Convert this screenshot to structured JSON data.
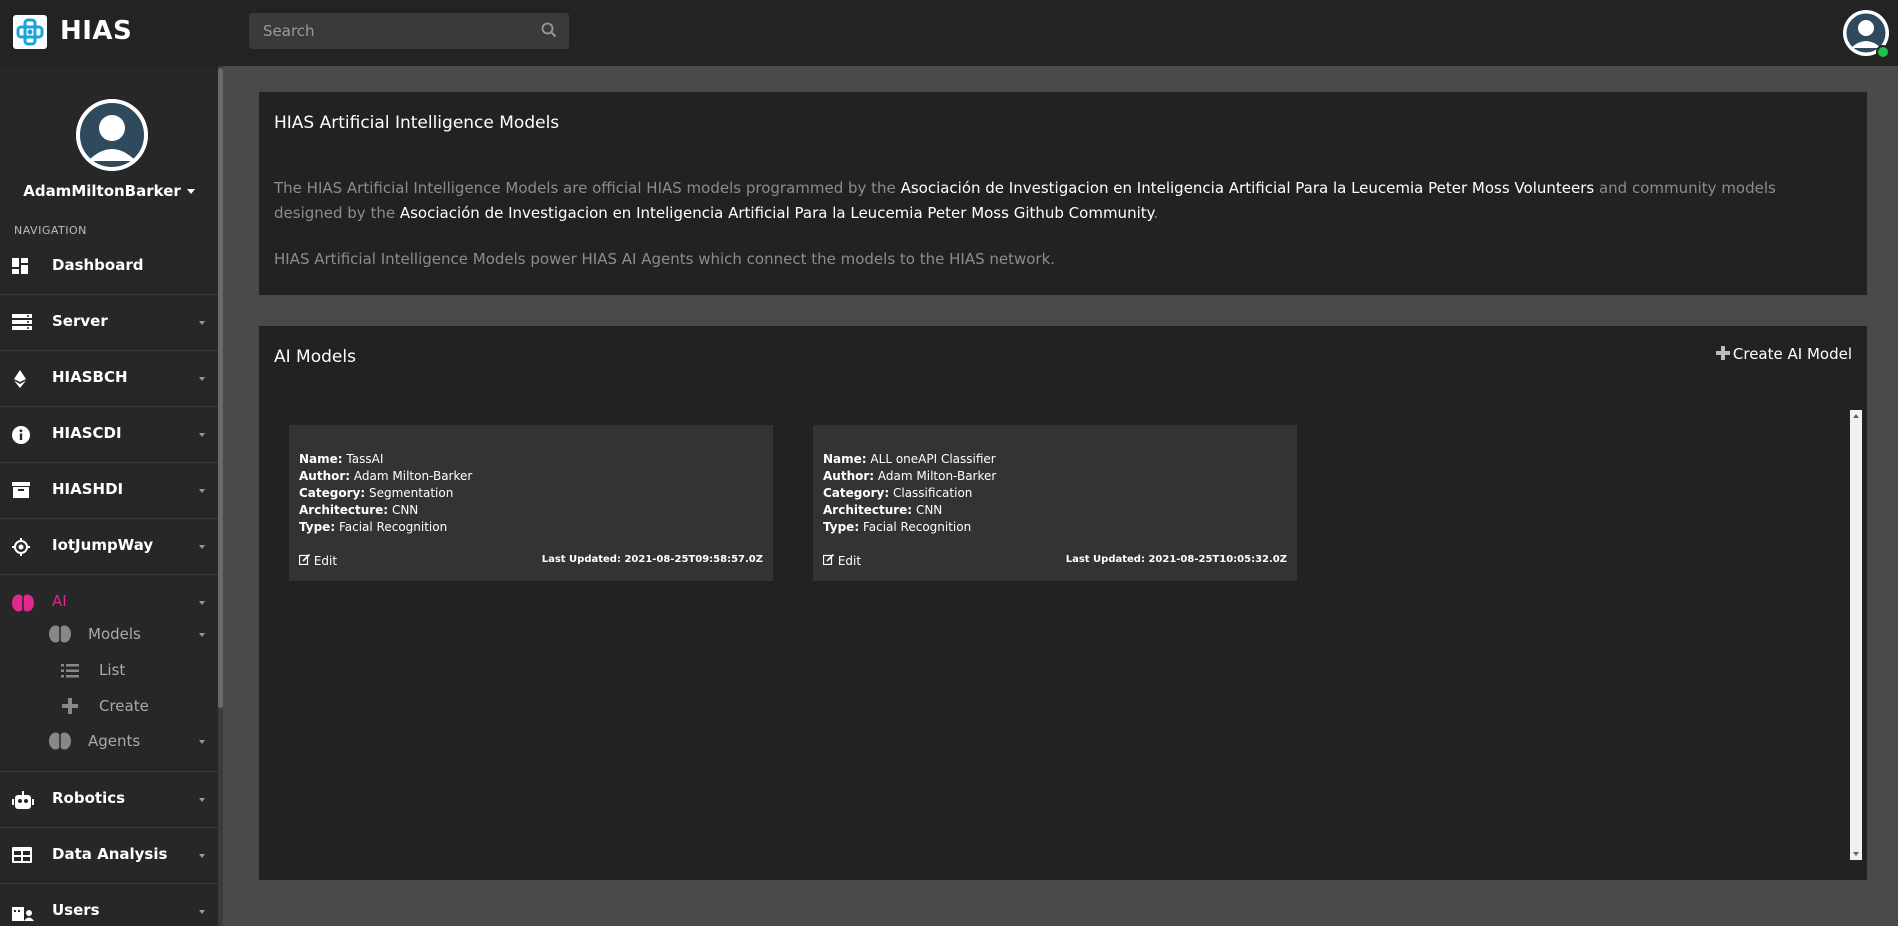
{
  "app": {
    "title": "HIAS"
  },
  "search": {
    "placeholder": "Search"
  },
  "user": {
    "name": "AdamMiltonBarker"
  },
  "nav": {
    "heading": "NAVIGATION",
    "items": [
      {
        "label": "Dashboard",
        "icon": "dashboard-icon"
      },
      {
        "label": "Server",
        "icon": "server-icon"
      },
      {
        "label": "HIASBCH",
        "icon": "ethereum-icon"
      },
      {
        "label": "HIASCDI",
        "icon": "info-icon"
      },
      {
        "label": "HIASHDI",
        "icon": "archive-icon"
      },
      {
        "label": "IotJumpWay",
        "icon": "chip-icon"
      },
      {
        "label": "AI",
        "icon": "brain-icon"
      },
      {
        "label": "Robotics",
        "icon": "robot-icon"
      },
      {
        "label": "Data Analysis",
        "icon": "table-icon"
      },
      {
        "label": "Users",
        "icon": "users-icon"
      }
    ],
    "ai_sub": {
      "models": "Models",
      "list": "List",
      "create": "Create",
      "agents": "Agents"
    }
  },
  "intro": {
    "title": "HIAS Artificial Intelligence Models",
    "p1_a": "The HIAS Artificial Intelligence Models are official HIAS models programmed by the ",
    "p1_b": "Asociación de Investigacion en Inteligencia Artificial Para la Leucemia Peter Moss Volunteers",
    "p1_c": " and community models designed by the ",
    "p1_d": "Asociación de Investigacion en Inteligencia Artificial Para la Leucemia Peter Moss Github Community",
    "p1_e": ".",
    "p2": "HIAS Artificial Intelligence Models power HIAS AI Agents which connect the models to the HIAS network."
  },
  "models_panel": {
    "title": "AI Models",
    "create_label": "Create AI Model"
  },
  "labels": {
    "name": "Name:",
    "author": "Author:",
    "category": "Category:",
    "architecture": "Architecture:",
    "type": "Type:",
    "edit": "Edit",
    "last_updated": "Last Updated:"
  },
  "models": [
    {
      "name": "TassAI",
      "author": "Adam Milton-Barker",
      "category": "Segmentation",
      "architecture": "CNN",
      "type": "Facial Recognition",
      "updated": "2021-08-25T09:58:57.0Z"
    },
    {
      "name": "ALL oneAPI Classifier",
      "author": "Adam Milton-Barker",
      "category": "Classification",
      "architecture": "CNN",
      "type": "Facial Recognition",
      "updated": "2021-08-25T10:05:32.0Z"
    }
  ],
  "colors": {
    "accent": "#e0298c",
    "topbar": "#232323",
    "sidebar": "#272727",
    "panel": "#222222",
    "card": "#333333",
    "online": "#1ec14a"
  }
}
